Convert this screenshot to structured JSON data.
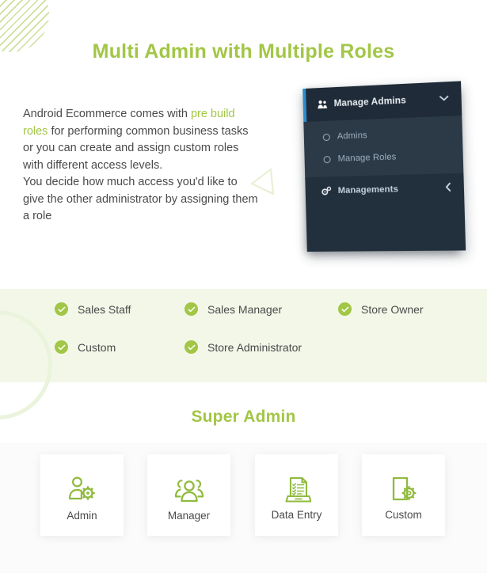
{
  "theme": {
    "accent_green": "#a2c646",
    "band_green": "#f3f7e8",
    "panel_dark": "#222f3d",
    "panel_header": "#1f2b38",
    "panel_submenu": "#2c3a47",
    "panel_accent_blue": "#2d8ccd",
    "body_text": "#4a4a4a"
  },
  "hero": {
    "title": "Multi Admin with Multiple Roles",
    "paragraph": {
      "part1": "Android Ecommerce comes with ",
      "highlight": "pre build roles",
      "part2": " for performing common business tasks or you can create and assign custom roles with different access levels.",
      "part3": "You decide how much access you'd like to give the other administrator by assigning them a role"
    }
  },
  "admin_panel": {
    "header": {
      "label": "Manage Admins",
      "icon": "users-icon",
      "chevron": "chevron-down-icon"
    },
    "submenu": [
      {
        "label": "Admins",
        "icon": "circle-icon"
      },
      {
        "label": "Manage Roles",
        "icon": "circle-icon"
      }
    ],
    "footer": {
      "label": "Managements",
      "icon": "gears-icon",
      "chevron": "chevron-left-icon"
    }
  },
  "roles_checklist": [
    "Sales Staff",
    "Sales Manager",
    "Store Owner",
    "Custom",
    "Store Administrator"
  ],
  "super_admin": {
    "title": "Super Admin",
    "cards": [
      {
        "label": "Admin",
        "icon": "user-gear-icon"
      },
      {
        "label": "Manager",
        "icon": "users-group-icon"
      },
      {
        "label": "Data Entry",
        "icon": "laptop-checklist-icon"
      },
      {
        "label": "Custom",
        "icon": "document-gear-icon"
      }
    ]
  }
}
